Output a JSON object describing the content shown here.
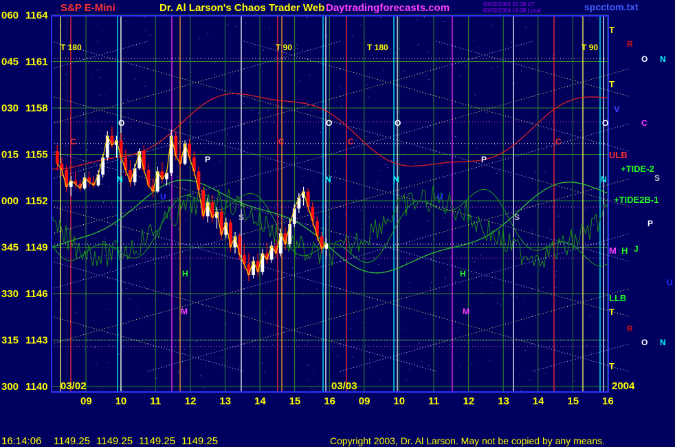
{
  "header": {
    "symbol": "S&P E-Mini",
    "title": "Dr. Al Larson's Chaos Trader Web",
    "site": "Daytradingforecasts.com",
    "stamp1": "03/02/2004 21:28 UT",
    "stamp2": "03/02/2004 16:28 Local",
    "file": "spcctom.txt"
  },
  "footer": {
    "time": "16:14:06",
    "quotes": [
      "1149.25",
      "1149.25",
      "1149.25",
      "1149.25"
    ],
    "copyright": "Copyright 2003, Dr. Al Larson. May not be copied by any means."
  },
  "chart_data": {
    "type": "candlestick",
    "y_left_labels": [
      "060",
      "045",
      "030",
      "015",
      "000",
      "345",
      "330",
      "315",
      "300"
    ],
    "y_labels": [
      "1164",
      "1161",
      "1158",
      "1155",
      "1152",
      "1149",
      "1146",
      "1143",
      "1140"
    ],
    "ylim": [
      1140,
      1164
    ],
    "x_hours": [
      "09",
      "10",
      "11",
      "12",
      "13",
      "14",
      "15",
      "16",
      "09",
      "10",
      "11",
      "12",
      "13",
      "14",
      "15",
      "16"
    ],
    "dates": [
      "03/02",
      "03/03"
    ],
    "year": "2004",
    "markers_top": [
      "T 180",
      "T 90",
      "T 180",
      "T 90"
    ],
    "right_labels": [
      "T",
      "T",
      "V",
      "ULB",
      "+TIDE-2",
      "+TIDE2B-1",
      "M",
      "H",
      "LLB",
      "T",
      "T"
    ],
    "planet_letters": [
      "R",
      "O",
      "N",
      "C",
      "S",
      "P",
      "J",
      "U",
      "R",
      "O",
      "N"
    ],
    "chart_letters": [
      "O",
      "C",
      "N",
      "P",
      "S",
      "H",
      "M",
      "V",
      "U"
    ],
    "candles": [
      {
        "o": 1155.2,
        "h": 1155.6,
        "l": 1154.0,
        "c": 1154.4
      },
      {
        "o": 1154.4,
        "h": 1154.8,
        "l": 1153.6,
        "c": 1154.0
      },
      {
        "o": 1154.0,
        "h": 1154.3,
        "l": 1152.6,
        "c": 1152.9
      },
      {
        "o": 1152.9,
        "h": 1153.6,
        "l": 1152.3,
        "c": 1153.3
      },
      {
        "o": 1153.3,
        "h": 1153.9,
        "l": 1152.8,
        "c": 1153.1
      },
      {
        "o": 1153.1,
        "h": 1153.4,
        "l": 1152.6,
        "c": 1152.8
      },
      {
        "o": 1152.8,
        "h": 1153.8,
        "l": 1152.7,
        "c": 1153.5
      },
      {
        "o": 1153.5,
        "h": 1153.9,
        "l": 1152.9,
        "c": 1153.2
      },
      {
        "o": 1153.2,
        "h": 1153.6,
        "l": 1152.8,
        "c": 1153.0
      },
      {
        "o": 1153.0,
        "h": 1154.0,
        "l": 1152.9,
        "c": 1153.7
      },
      {
        "o": 1153.7,
        "h": 1155.0,
        "l": 1153.5,
        "c": 1154.8
      },
      {
        "o": 1154.8,
        "h": 1156.5,
        "l": 1154.6,
        "c": 1156.2
      },
      {
        "o": 1156.2,
        "h": 1156.8,
        "l": 1155.4,
        "c": 1155.6
      },
      {
        "o": 1155.6,
        "h": 1156.2,
        "l": 1154.8,
        "c": 1155.9
      },
      {
        "o": 1155.9,
        "h": 1156.4,
        "l": 1154.6,
        "c": 1154.8
      },
      {
        "o": 1154.8,
        "h": 1155.3,
        "l": 1153.6,
        "c": 1154.0
      },
      {
        "o": 1154.0,
        "h": 1154.6,
        "l": 1152.9,
        "c": 1153.2
      },
      {
        "o": 1153.2,
        "h": 1154.4,
        "l": 1153.0,
        "c": 1154.1
      },
      {
        "o": 1154.1,
        "h": 1155.4,
        "l": 1154.0,
        "c": 1155.2
      },
      {
        "o": 1155.2,
        "h": 1155.6,
        "l": 1153.8,
        "c": 1154.0
      },
      {
        "o": 1154.0,
        "h": 1154.4,
        "l": 1152.8,
        "c": 1153.0
      },
      {
        "o": 1153.0,
        "h": 1153.5,
        "l": 1152.2,
        "c": 1152.6
      },
      {
        "o": 1152.6,
        "h": 1154.2,
        "l": 1152.5,
        "c": 1153.9
      },
      {
        "o": 1153.9,
        "h": 1154.5,
        "l": 1153.2,
        "c": 1153.4
      },
      {
        "o": 1153.4,
        "h": 1154.0,
        "l": 1153.0,
        "c": 1153.8
      },
      {
        "o": 1153.8,
        "h": 1156.6,
        "l": 1153.6,
        "c": 1156.2
      },
      {
        "o": 1156.2,
        "h": 1156.5,
        "l": 1154.6,
        "c": 1154.9
      },
      {
        "o": 1154.9,
        "h": 1155.4,
        "l": 1154.2,
        "c": 1154.4
      },
      {
        "o": 1154.4,
        "h": 1155.9,
        "l": 1154.3,
        "c": 1155.7
      },
      {
        "o": 1155.7,
        "h": 1156.0,
        "l": 1154.6,
        "c": 1154.8
      },
      {
        "o": 1154.8,
        "h": 1155.2,
        "l": 1153.6,
        "c": 1153.9
      },
      {
        "o": 1153.9,
        "h": 1154.2,
        "l": 1152.4,
        "c": 1152.7
      },
      {
        "o": 1152.7,
        "h": 1152.9,
        "l": 1150.8,
        "c": 1151.0
      },
      {
        "o": 1151.0,
        "h": 1152.2,
        "l": 1150.6,
        "c": 1151.9
      },
      {
        "o": 1151.9,
        "h": 1152.4,
        "l": 1150.6,
        "c": 1150.9
      },
      {
        "o": 1150.9,
        "h": 1151.6,
        "l": 1150.2,
        "c": 1151.3
      },
      {
        "o": 1151.3,
        "h": 1151.5,
        "l": 1149.5,
        "c": 1149.8
      },
      {
        "o": 1149.8,
        "h": 1150.9,
        "l": 1149.6,
        "c": 1150.6
      },
      {
        "o": 1150.6,
        "h": 1150.8,
        "l": 1148.7,
        "c": 1149.0
      },
      {
        "o": 1149.0,
        "h": 1150.0,
        "l": 1148.6,
        "c": 1149.7
      },
      {
        "o": 1149.7,
        "h": 1149.9,
        "l": 1148.2,
        "c": 1148.5
      },
      {
        "o": 1148.5,
        "h": 1149.2,
        "l": 1147.6,
        "c": 1147.9
      },
      {
        "o": 1147.9,
        "h": 1148.6,
        "l": 1146.8,
        "c": 1147.2
      },
      {
        "o": 1147.2,
        "h": 1148.4,
        "l": 1147.0,
        "c": 1148.1
      },
      {
        "o": 1148.1,
        "h": 1148.6,
        "l": 1147.1,
        "c": 1147.4
      },
      {
        "o": 1147.4,
        "h": 1148.9,
        "l": 1147.2,
        "c": 1148.6
      },
      {
        "o": 1148.6,
        "h": 1149.3,
        "l": 1147.9,
        "c": 1148.2
      },
      {
        "o": 1148.2,
        "h": 1149.4,
        "l": 1148.0,
        "c": 1149.1
      },
      {
        "o": 1149.1,
        "h": 1149.5,
        "l": 1148.3,
        "c": 1148.6
      },
      {
        "o": 1148.6,
        "h": 1150.2,
        "l": 1148.4,
        "c": 1149.9
      },
      {
        "o": 1149.9,
        "h": 1150.3,
        "l": 1148.8,
        "c": 1149.2
      },
      {
        "o": 1149.2,
        "h": 1150.8,
        "l": 1149.0,
        "c": 1150.5
      },
      {
        "o": 1150.5,
        "h": 1151.8,
        "l": 1150.3,
        "c": 1151.5
      },
      {
        "o": 1151.5,
        "h": 1152.5,
        "l": 1151.2,
        "c": 1152.2
      },
      {
        "o": 1152.2,
        "h": 1152.9,
        "l": 1151.7,
        "c": 1152.6
      },
      {
        "o": 1152.6,
        "h": 1152.8,
        "l": 1151.3,
        "c": 1151.6
      },
      {
        "o": 1151.6,
        "h": 1151.9,
        "l": 1150.4,
        "c": 1150.7
      },
      {
        "o": 1150.7,
        "h": 1151.0,
        "l": 1149.4,
        "c": 1149.7
      },
      {
        "o": 1149.7,
        "h": 1150.0,
        "l": 1148.6,
        "c": 1148.9
      },
      {
        "o": 1148.9,
        "h": 1149.6,
        "l": 1148.4,
        "c": 1149.25
      }
    ]
  }
}
